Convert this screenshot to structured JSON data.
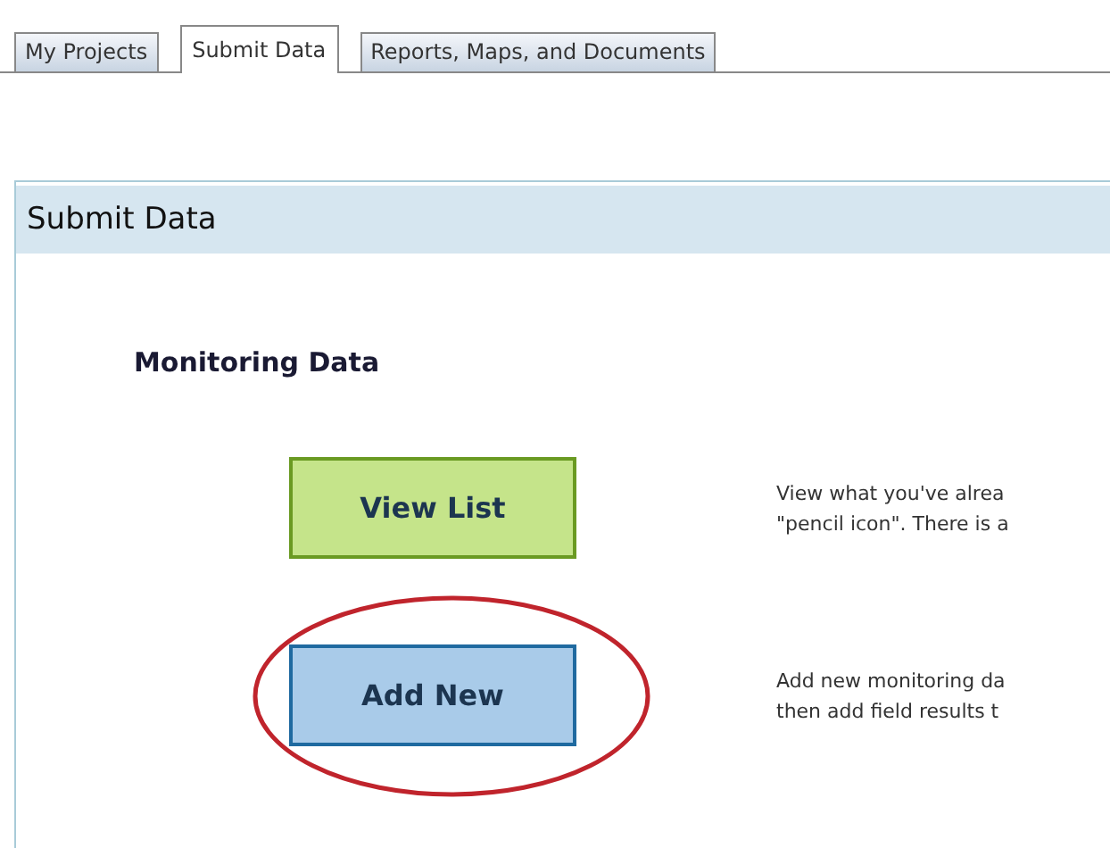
{
  "tabs": [
    {
      "label": "My Projects",
      "selected": false
    },
    {
      "label": "Submit Data",
      "selected": true
    },
    {
      "label": "Reports, Maps, and Documents",
      "selected": false
    }
  ],
  "panel": {
    "title": "Submit Data",
    "section": "Monitoring Data",
    "actions": [
      {
        "kind": "view",
        "label": "View List",
        "circled": false,
        "description": [
          "View what you've alrea",
          "\"pencil icon\". There is a"
        ]
      },
      {
        "kind": "add",
        "label": "Add New",
        "circled": true,
        "description": [
          "Add new monitoring da",
          "then add field results t"
        ]
      }
    ]
  }
}
